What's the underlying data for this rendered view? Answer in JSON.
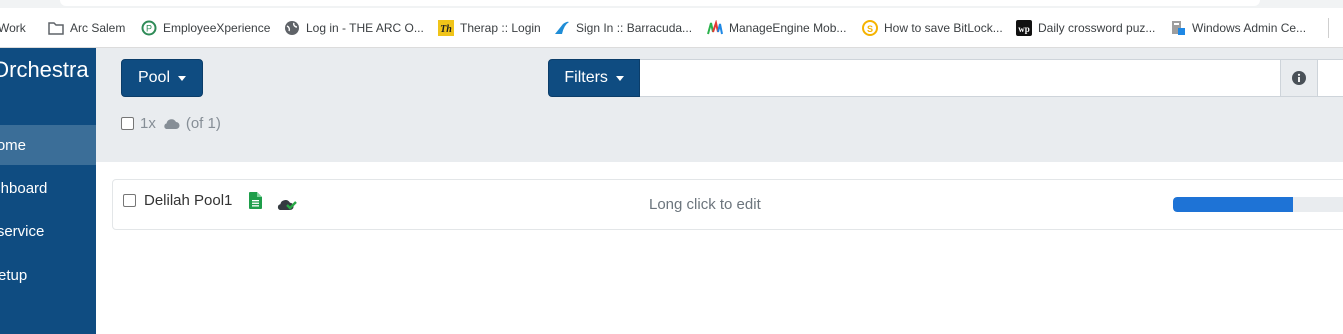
{
  "bookmarks": [
    {
      "label": "Work",
      "icon": "folder-icon"
    },
    {
      "label": "Arc Salem",
      "icon": "folder-icon"
    },
    {
      "label": "EmployeeXperience",
      "icon": "employeexperience-icon"
    },
    {
      "label": "Log in - THE ARC O...",
      "icon": "globe-icon"
    },
    {
      "label": "Therap :: Login",
      "icon": "therap-icon"
    },
    {
      "label": "Sign In :: Barracuda...",
      "icon": "barracuda-icon"
    },
    {
      "label": "ManageEngine Mob...",
      "icon": "manageengine-icon"
    },
    {
      "label": "How to save BitLock...",
      "icon": "coin-icon"
    },
    {
      "label": "Daily crossword puz...",
      "icon": "washington-post-icon"
    },
    {
      "label": "Windows Admin Ce...",
      "icon": "windows-admin-icon"
    }
  ],
  "sidebar": {
    "brand": "Orchestra",
    "items": [
      {
        "label": "Home",
        "active": true
      },
      {
        "label": "Dashboard",
        "active": false
      },
      {
        "label": "Self-service",
        "active": false
      },
      {
        "label": "Setup",
        "active": false
      }
    ]
  },
  "toolbar": {
    "pool_label": "Pool",
    "filters_label": "Filters",
    "filter_value": "",
    "count_text": "1x",
    "count_of": "(of 1)"
  },
  "pools": [
    {
      "name": "Delilah Pool1",
      "hint": "Long click to edit",
      "progress": 0.6
    }
  ],
  "colors": {
    "primary": "#0f4c81",
    "progress": "#1e73d6",
    "sidebar_active": "#3b6e98"
  }
}
